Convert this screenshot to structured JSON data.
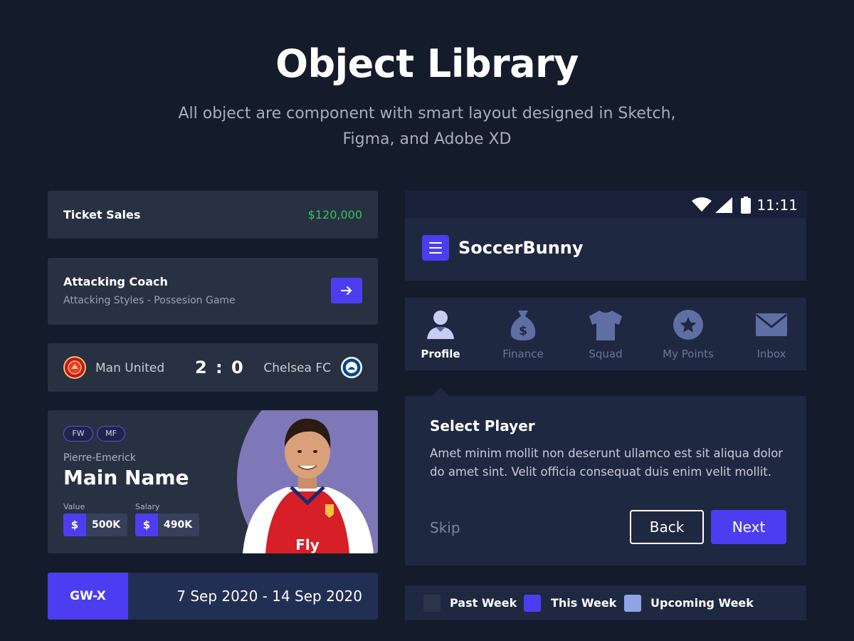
{
  "header": {
    "title": "Object Library",
    "subtitle": "All object are component with smart layout designed in Sketch, Figma, and Adobe XD"
  },
  "ticket": {
    "label": "Ticket Sales",
    "value": "$120,000"
  },
  "coach": {
    "title": "Attacking Coach",
    "subtitle": "Attacking Styles - Possesion Game"
  },
  "match": {
    "home": "Man United",
    "score": "2 : 0",
    "away": "Chelsea FC"
  },
  "player": {
    "positions": [
      "FW",
      "MF"
    ],
    "first_name": "Pierre-Emerick",
    "main_name": "Main Name",
    "value_label": "Value",
    "value": "500K",
    "salary_label": "Salary",
    "salary": "490K",
    "currency_symbol": "$",
    "shirt_text": "Fly"
  },
  "gameweek": {
    "label": "GW-X",
    "dates": "7 Sep 2020 -  14 Sep 2020"
  },
  "status_bar": {
    "time": "11:11"
  },
  "app": {
    "name": "SoccerBunny"
  },
  "nav": {
    "items": [
      {
        "label": "Profile",
        "icon": "profile-icon",
        "active": true
      },
      {
        "label": "Finance",
        "icon": "money-bag-icon"
      },
      {
        "label": "Squad",
        "icon": "shirt-icon"
      },
      {
        "label": "My Points",
        "icon": "star-icon"
      },
      {
        "label": "Inbox",
        "icon": "mail-icon"
      }
    ]
  },
  "dialog": {
    "title": "Select Player",
    "body": "Amet minim mollit non deserunt ullamco est sit aliqua dolor do amet sint. Velit officia consequat duis enim velit mollit.",
    "skip": "Skip",
    "back": "Back",
    "next": "Next"
  },
  "legend": {
    "items": [
      {
        "label": "Past Week",
        "color": "#2c354a"
      },
      {
        "label": "This Week",
        "color": "#4c3ef0"
      },
      {
        "label": "Upcoming Week",
        "color": "#8fa4e6"
      }
    ]
  },
  "colors": {
    "background": "#141b2b",
    "card": "#283141",
    "accent": "#4c3ef0",
    "positive": "#35c35c"
  }
}
